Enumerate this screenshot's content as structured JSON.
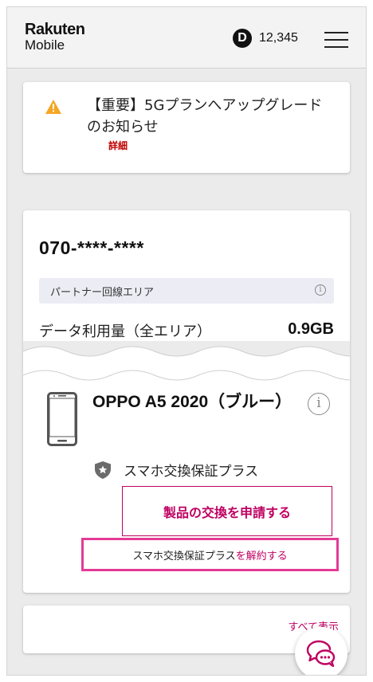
{
  "header": {
    "logo_line1": "Rakuten",
    "logo_line2": "Mobile",
    "points_badge": "D",
    "points": "12,345",
    "menu_icon": "hamburger-menu-icon"
  },
  "notice": {
    "icon": "warning-triangle-icon",
    "title": "【重要】5Gプランへアップグレードのお知らせ",
    "link": "詳細"
  },
  "line": {
    "phone_number": "070-****-****",
    "area_label": "パートナー回線エリア",
    "area_info_icon": "info-icon",
    "usage_label": "データ利用量（全エリア）",
    "usage_value": "0.9GB"
  },
  "device": {
    "icon": "smartphone-icon",
    "name": "OPPO A5 2020（ブルー）",
    "info_icon": "info-icon",
    "insurance_icon": "shield-star-icon",
    "insurance_label": "スマホ交換保証プラス",
    "apply_button": "製品の交換を申請する",
    "cancel_text": "スマホ交換保証プラス",
    "cancel_link": "を解約する"
  },
  "bottom": {
    "see_all": "すべて表示"
  },
  "chat": {
    "icon": "chat-bubbles-icon"
  },
  "colors": {
    "brand": "#bf0000",
    "accent": "#bf0061",
    "highlight": "#e53a96",
    "warning": "#f5a623"
  }
}
